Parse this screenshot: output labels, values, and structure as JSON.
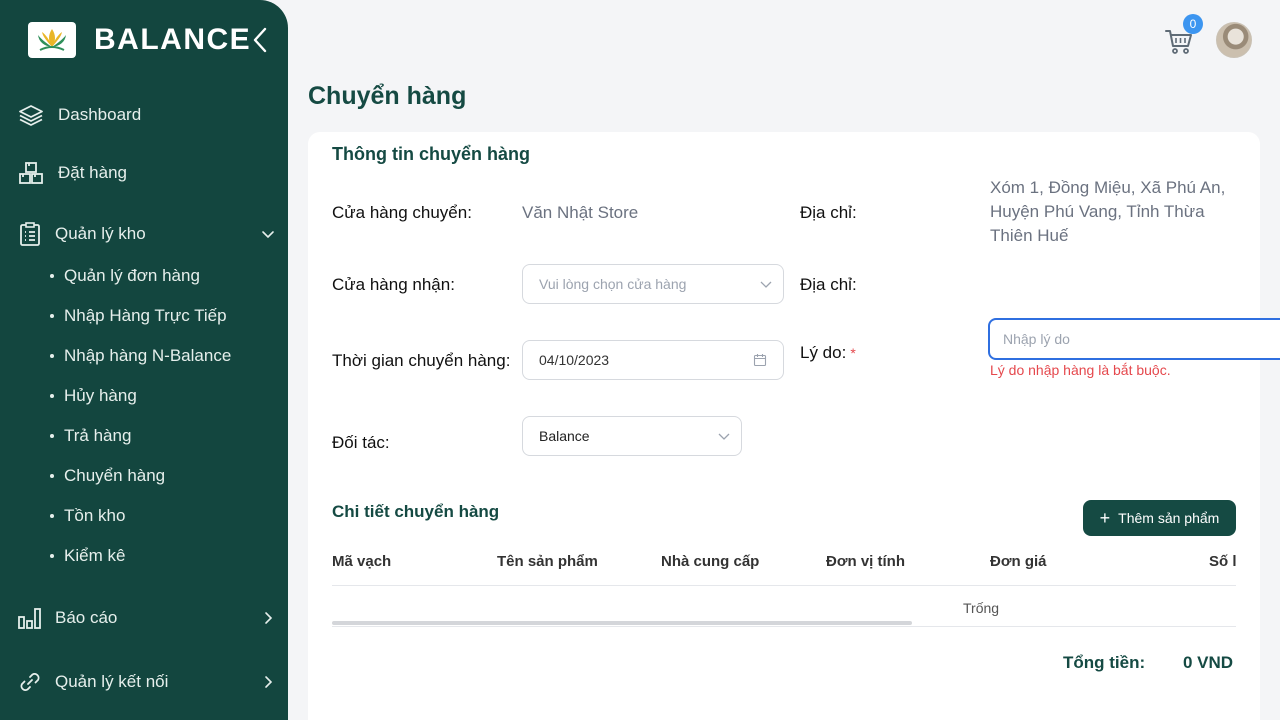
{
  "brand": {
    "name": "BALANCE"
  },
  "sidebar": {
    "items": [
      {
        "label": "Dashboard",
        "icon": "layers-icon"
      },
      {
        "label": "Đặt hàng",
        "icon": "boxes-icon"
      },
      {
        "label": "Quản lý kho",
        "icon": "clipboard-icon",
        "expanded": true,
        "children": [
          "Quản lý đơn hàng",
          "Nhập Hàng Trực Tiếp",
          "Nhập hàng N-Balance",
          "Hủy hàng",
          "Trả hàng",
          "Chuyển hàng",
          "Tồn kho",
          "Kiểm kê"
        ]
      },
      {
        "label": "Báo cáo",
        "icon": "bar-chart-icon"
      },
      {
        "label": "Quản lý kết nối",
        "icon": "link-icon"
      }
    ]
  },
  "header": {
    "cart_count": "0"
  },
  "page": {
    "title": "Chuyển hàng"
  },
  "info": {
    "title": "Thông tin chuyển hàng",
    "from_store_label": "Cửa hàng chuyển:",
    "from_store_value": "Văn Nhật Store",
    "address_label": "Địa chỉ:",
    "address_value": "Xóm 1, Đồng Miệu, Xã Phú An, Huyện Phú Vang, Tỉnh Thừa Thiên Huế",
    "to_store_label": "Cửa hàng nhận:",
    "to_store_placeholder": "Vui lòng chọn cửa hàng",
    "address2_label": "Địa chỉ:",
    "date_label": "Thời gian chuyển hàng:",
    "date_value": "04/10/2023",
    "reason_label": "Lý do:",
    "reason_required": "*",
    "reason_placeholder": "Nhập lý do",
    "reason_error": "Lý do nhập hàng là bắt buộc.",
    "partner_label": "Đối tác:",
    "partner_value": "Balance"
  },
  "detail": {
    "title": "Chi tiết chuyển hàng",
    "add_button": "Thêm sản phẩm",
    "columns": [
      "Mã vạch",
      "Tên sản phẩm",
      "Nhà cung cấp",
      "Đơn vị tính",
      "Đơn giá",
      "Số l"
    ],
    "empty_text": "Trống",
    "total_label": "Tổng tiền:",
    "total_value": "0 VND"
  },
  "colors": {
    "primary": "#154a43",
    "sidebar": "#13463f",
    "focus": "#2f6fe0",
    "error": "#e5484d",
    "badge": "#3c95f0"
  }
}
